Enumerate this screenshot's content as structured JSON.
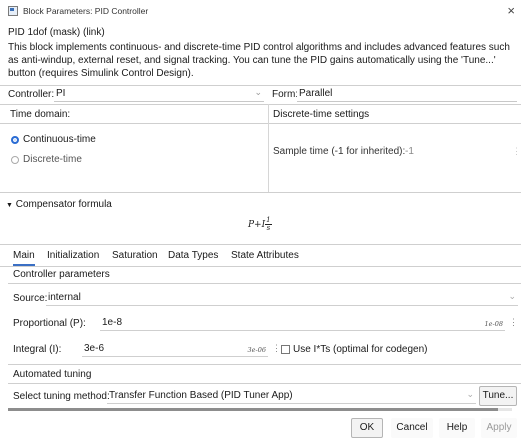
{
  "window": {
    "title": "Block Parameters: PID Controller",
    "close_glyph": "×"
  },
  "block": {
    "name": "PID 1dof (mask) (link)",
    "description": "This block implements continuous- and discrete-time PID control algorithms and includes advanced features such as anti-windup, external reset, and signal tracking. You can tune the PID gains automatically using the 'Tune...' button (requires Simulink Control Design)."
  },
  "controller": {
    "label": "Controller:",
    "value": "PI"
  },
  "form": {
    "label": "Form:",
    "value": "Parallel"
  },
  "time_domain": {
    "label": "Time domain:",
    "options": [
      "Continuous-time",
      "Discrete-time"
    ],
    "selected": "Continuous-time"
  },
  "discrete": {
    "label": "Discrete-time settings",
    "sample_time_label": "Sample time (-1 for inherited):",
    "sample_time_value": "-1"
  },
  "compensator": {
    "label": "Compensator formula",
    "formula_prefix": "P+I",
    "frac_num": "1",
    "frac_den": "s"
  },
  "tabs": [
    "Main",
    "Initialization",
    "Saturation",
    "Data Types",
    "State Attributes"
  ],
  "active_tab": "Main",
  "main": {
    "section_label": "Controller parameters",
    "source": {
      "label": "Source:",
      "value": "internal"
    },
    "proportional": {
      "label": "Proportional (P):",
      "value": "1e-8",
      "hint": "1e-08"
    },
    "integral": {
      "label": "Integral (I):",
      "value": "3e-6",
      "hint": "3e-06"
    },
    "use_its": {
      "label": "Use I*Ts (optimal for codegen)",
      "checked": false
    }
  },
  "tuning": {
    "section_label": "Automated tuning",
    "method_label": "Select tuning method:",
    "method_value": "Transfer Function Based (PID Tuner App)",
    "tune_button": "Tune..."
  },
  "buttons": {
    "ok": "OK",
    "cancel": "Cancel",
    "help": "Help",
    "apply": "Apply"
  },
  "icons": {
    "chevron": "⌄",
    "kebab": "⋮"
  }
}
